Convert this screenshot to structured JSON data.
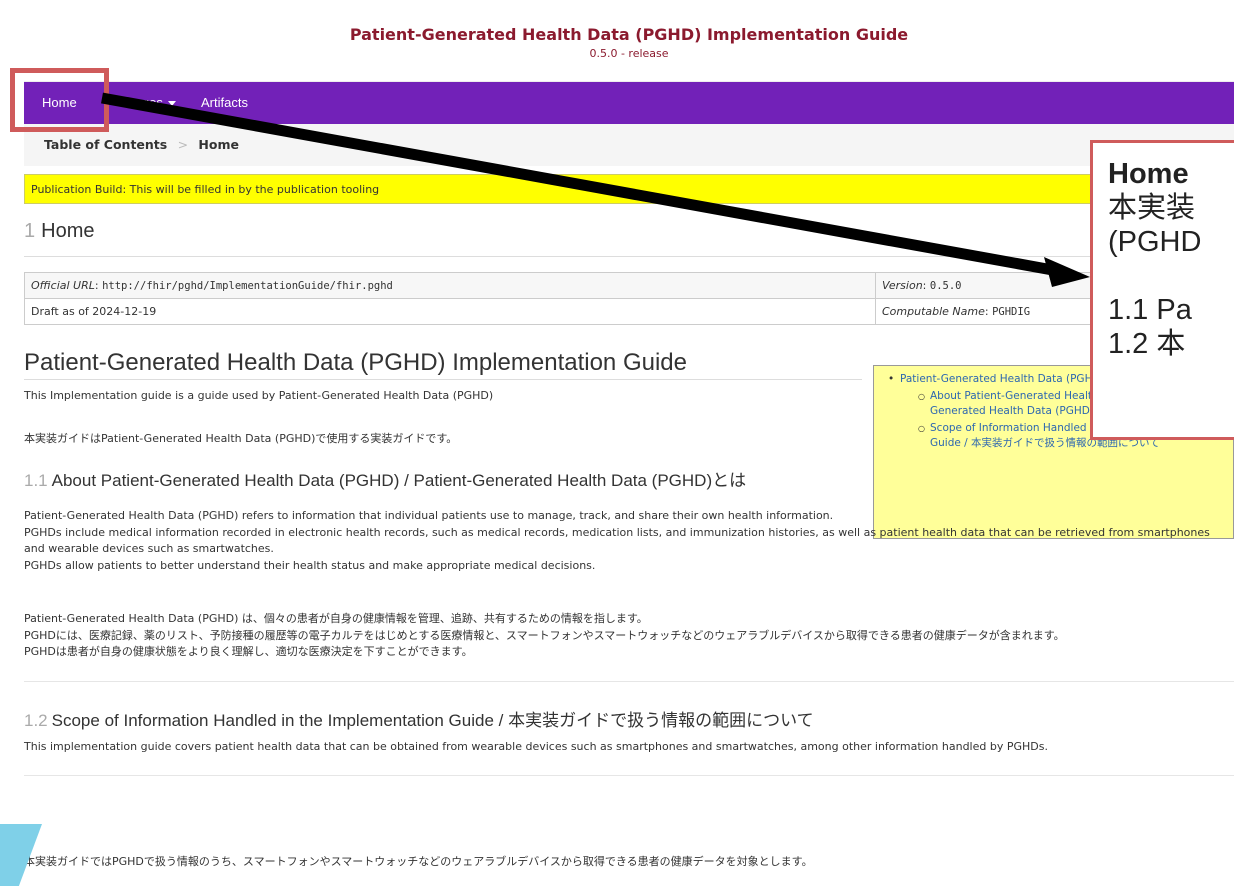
{
  "header": {
    "title": "Patient-Generated Health Data (PGHD) Implementation Guide",
    "version": "0.5.0 - release"
  },
  "nav": {
    "items": [
      "Home",
      "Pages",
      "Artifacts"
    ]
  },
  "breadcrumb": {
    "root": "Table of Contents",
    "separator": ">",
    "current": "Home"
  },
  "publication_banner": "Publication Build: This will be filled in by the publication tooling",
  "section": {
    "number": "1",
    "title": "Home"
  },
  "meta": {
    "official_url_label": "Official URL",
    "official_url": "http://fhir/pghd/ImplementationGuide/fhir.pghd",
    "version_label": "Version",
    "version": "0.5.0",
    "draft": "Draft as of 2024-12-19",
    "computable_name_label": "Computable Name",
    "computable_name": "PGHDIG"
  },
  "guide": {
    "title": "Patient-Generated Health Data (PGHD) Implementation Guide",
    "intro_en": "This Implementation guide is a guide used by Patient-Generated Health Data (PGHD)",
    "intro_ja": "本実装ガイドはPatient-Generated Health Data (PGHD)で使用する実装ガイドです。"
  },
  "toc": {
    "root": "Patient-Generated Health Data (PGHD) Implementation Guide",
    "items": [
      "About Patient-Generated Health Data (PGHD) / Patient-Generated Health Data (PGHD)とは",
      "Scope of Information Handled in the Implementation Guide / 本実装ガイドで扱う情報の範囲について"
    ]
  },
  "about": {
    "number": "1.1",
    "title": "About Patient-Generated Health Data (PGHD) / Patient-Generated Health Data (PGHD)とは",
    "en": [
      "Patient-Generated Health Data (PGHD) refers to information that individual patients use to manage, track, and share their own health information.",
      "PGHDs include medical information recorded in electronic health records, such as medical records, medication lists, and immunization histories, as well as patient health data that can be retrieved from smartphones and wearable devices such as smartwatches.",
      "PGHDs allow patients to better understand their health status and make appropriate medical decisions."
    ],
    "ja": [
      "Patient-Generated Health Data (PGHD) は、個々の患者が自身の健康情報を管理、追跡、共有するための情報を指します。",
      "PGHDには、医療記録、薬のリスト、予防接種の履歴等の電子カルテをはじめとする医療情報と、スマートフォンやスマートウォッチなどのウェアラブルデバイスから取得できる患者の健康データが含まれます。",
      "PGHDは患者が自身の健康状態をより良く理解し、適切な医療決定を下すことができます。"
    ]
  },
  "scope": {
    "number": "1.2",
    "title": "Scope of Information Handled in the Implementation Guide / 本実装ガイドで扱う情報の範囲について",
    "en": "This implementation guide covers patient health data that can be obtained from wearable devices such as smartphones and smartwatches, among other information handled by PGHDs.",
    "ja": "本実装ガイドではPGHDで扱う情報のうち、スマートフォンやスマートウォッチなどのウェアラブルデバイスから取得できる患者の健康データを対象とします。"
  },
  "callout": {
    "title": "Home",
    "lines": [
      "本実装",
      "(PGHD"
    ],
    "items": [
      "1.1 Pa",
      "1.2 本"
    ]
  },
  "colors": {
    "nav_bg": "#7221b8",
    "title_color": "#8b1a2e",
    "banner_bg": "#ffff00",
    "toc_bg": "#ffff99",
    "callout_border": "#cf5b5b"
  }
}
